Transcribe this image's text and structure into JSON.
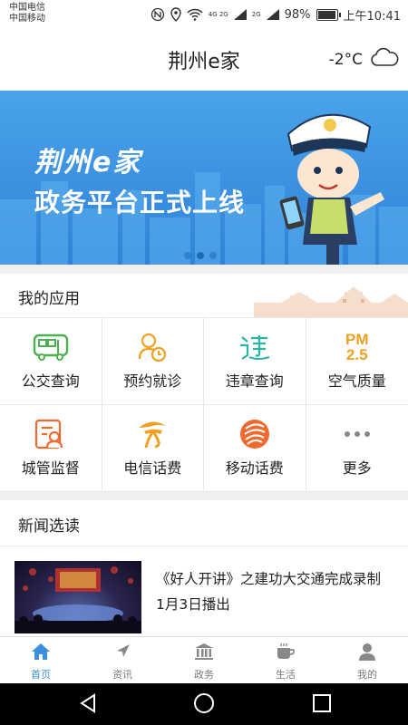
{
  "status_bar": {
    "carrier_1": "中国电信",
    "carrier_2": "中国移动",
    "signal_1": "4G 2G",
    "signal_2": "2G",
    "battery": "98%",
    "battery_level": 0.98,
    "time": "上午10:41"
  },
  "header": {
    "title": "荆州e家",
    "temperature": "-2°C",
    "weather_icon": "cloud-icon"
  },
  "banner": {
    "logo_text": "荆州e家",
    "slogan": "政务平台正式上线",
    "slide_count": 3,
    "active_slide": 2
  },
  "apps": {
    "section_title": "我的应用",
    "items": [
      {
        "label": "公交查询",
        "icon": "bus-icon",
        "color": "#4caf50"
      },
      {
        "label": "预约就诊",
        "icon": "doctor-appointment-icon",
        "color": "#f0a020"
      },
      {
        "label": "违章查询",
        "icon": "traffic-violation-icon",
        "color": "#2bb3a6"
      },
      {
        "label": "空气质量",
        "icon": "pm25-icon",
        "icon_text_1": "PM",
        "icon_text_2": "2.5",
        "color": "#f0a020"
      },
      {
        "label": "城管监督",
        "icon": "city-management-icon",
        "color": "#f06a30"
      },
      {
        "label": "电信话费",
        "icon": "telecom-icon",
        "color": "#f0a020"
      },
      {
        "label": "移动话费",
        "icon": "mobile-icon",
        "color": "#f06a30"
      },
      {
        "label": "更多",
        "icon": "more-icon",
        "color": "#888888"
      }
    ]
  },
  "news": {
    "section_title": "新闻选读",
    "item": {
      "headline": "《好人开讲》之建功大交通完成录制 1月3日播出"
    }
  },
  "tabs": [
    {
      "label": "首页",
      "icon": "home-icon",
      "active": true
    },
    {
      "label": "资讯",
      "icon": "compass-icon",
      "active": false
    },
    {
      "label": "政务",
      "icon": "government-icon",
      "active": false
    },
    {
      "label": "生活",
      "icon": "cup-icon",
      "active": false
    },
    {
      "label": "我的",
      "icon": "user-icon",
      "active": false
    }
  ],
  "colors": {
    "accent": "#3a8fdf",
    "banner_blue": "#3a8fdf"
  }
}
